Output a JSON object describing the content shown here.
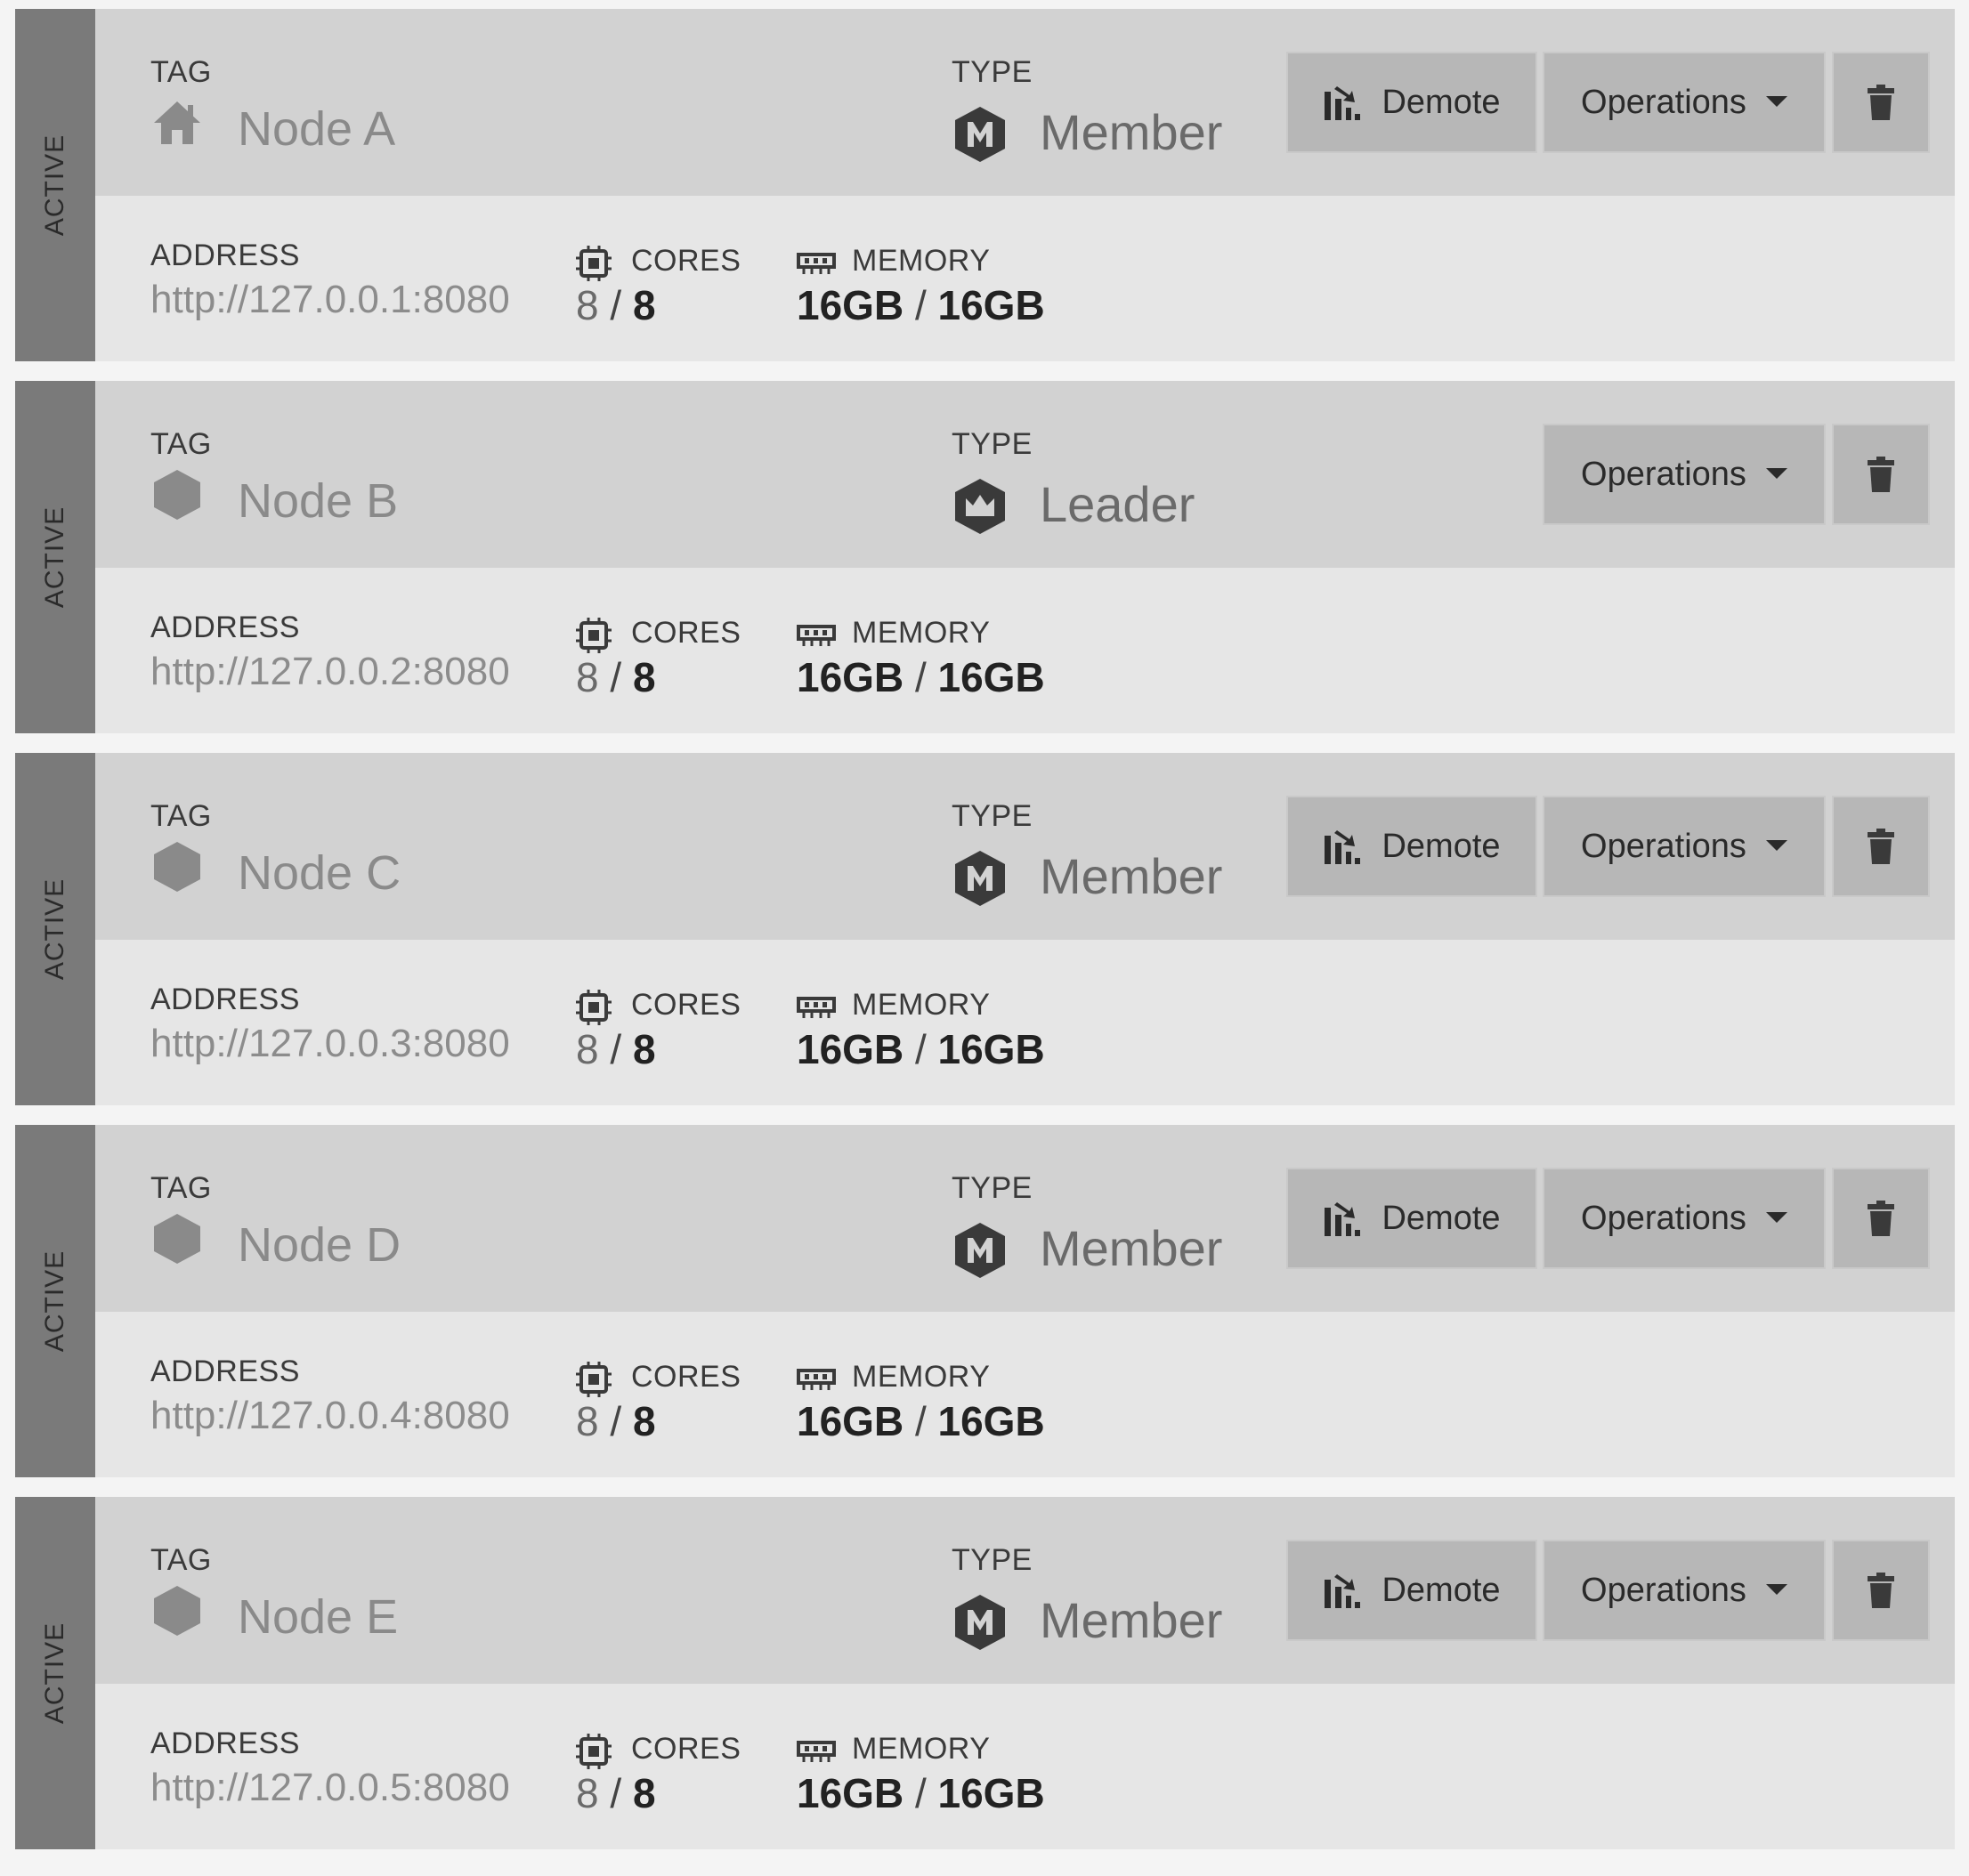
{
  "labels": {
    "tag": "TAG",
    "type": "TYPE",
    "address": "ADDRESS",
    "cores": "CORES",
    "memory": "MEMORY",
    "demote": "Demote",
    "operations": "Operations",
    "separator": "/"
  },
  "colors": {
    "status_strip": "#7a7a7a",
    "header_bg": "#d2d2d2",
    "details_bg": "#e6e6e6",
    "button_bg": "#b7b7b7"
  },
  "nodes": [
    {
      "status": "ACTIVE",
      "tag_icon": "home-icon",
      "tag": "Node A",
      "type_icon": "member-hexagon-icon",
      "type": "Member",
      "show_demote": true,
      "address": "http://127.0.0.1:8080",
      "cores_used": "8",
      "cores_total": "8",
      "memory_used": "16GB",
      "memory_total": "16GB"
    },
    {
      "status": "ACTIVE",
      "tag_icon": "hexagon-icon",
      "tag": "Node B",
      "type_icon": "leader-crown-icon",
      "type": "Leader",
      "show_demote": false,
      "address": "http://127.0.0.2:8080",
      "cores_used": "8",
      "cores_total": "8",
      "memory_used": "16GB",
      "memory_total": "16GB"
    },
    {
      "status": "ACTIVE",
      "tag_icon": "hexagon-icon",
      "tag": "Node C",
      "type_icon": "member-hexagon-icon",
      "type": "Member",
      "show_demote": true,
      "address": "http://127.0.0.3:8080",
      "cores_used": "8",
      "cores_total": "8",
      "memory_used": "16GB",
      "memory_total": "16GB"
    },
    {
      "status": "ACTIVE",
      "tag_icon": "hexagon-icon",
      "tag": "Node D",
      "type_icon": "member-hexagon-icon",
      "type": "Member",
      "show_demote": true,
      "address": "http://127.0.0.4:8080",
      "cores_used": "8",
      "cores_total": "8",
      "memory_used": "16GB",
      "memory_total": "16GB"
    },
    {
      "status": "ACTIVE",
      "tag_icon": "hexagon-icon",
      "tag": "Node E",
      "type_icon": "member-hexagon-icon",
      "type": "Member",
      "show_demote": true,
      "address": "http://127.0.0.5:8080",
      "cores_used": "8",
      "cores_total": "8",
      "memory_used": "16GB",
      "memory_total": "16GB"
    }
  ]
}
